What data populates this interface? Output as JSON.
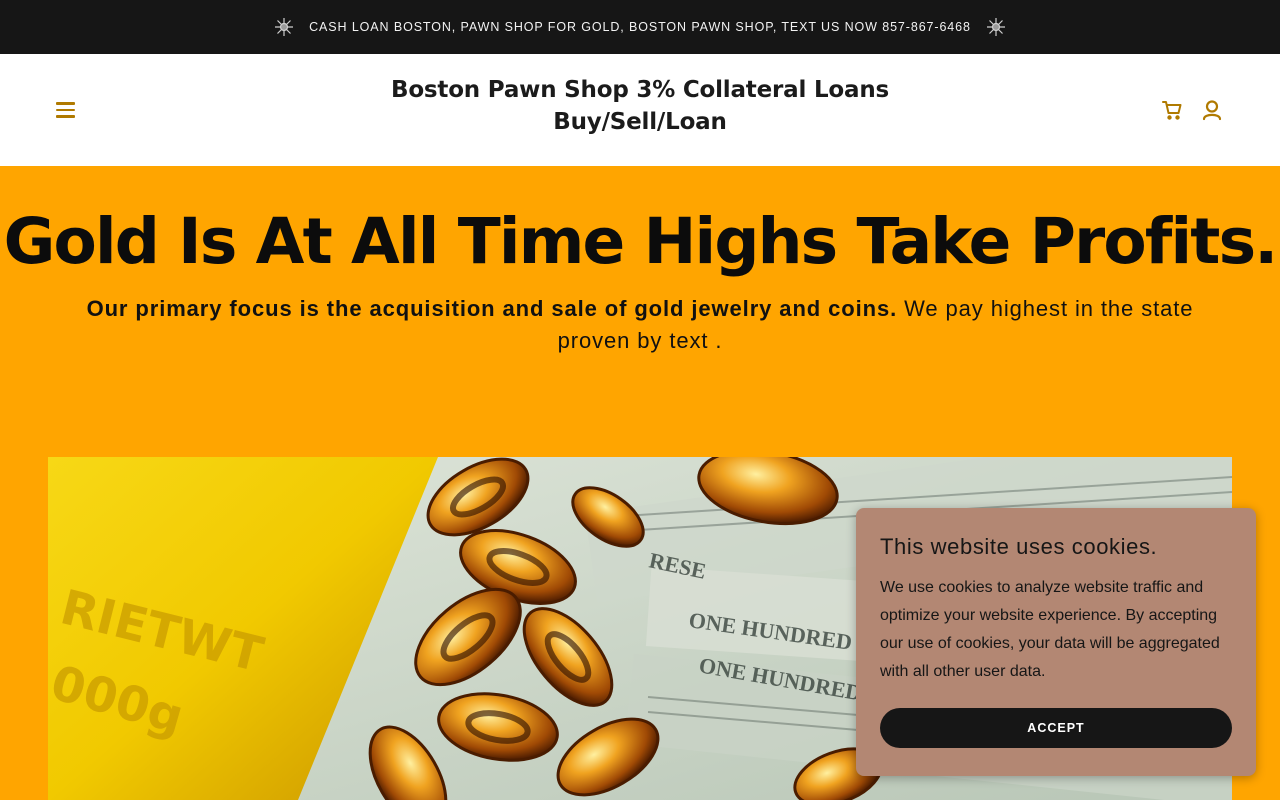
{
  "announcement": {
    "text": "CASH LOAN BOSTON, PAWN SHOP FOR GOLD, BOSTON PAWN SHOP, TEXT US NOW 857-867-6468",
    "icon": "sparkle-icon"
  },
  "header": {
    "title_line1": "Boston Pawn Shop 3% Collateral Loans",
    "title_line2": "Buy/Sell/Loan",
    "menu_icon": "hamburger-menu-icon",
    "cart_icon": "shopping-cart-icon",
    "account_icon": "user-account-icon",
    "icon_color": "#b07a00"
  },
  "hero": {
    "heading": "Gold Is At All Time Highs Take Profits.",
    "text_bold": "Our primary focus is the acquisition and sale of gold jewelry and coins.",
    "text_regular": " We pay highest in the state proven by text .",
    "background": "#ffa500",
    "image_text": [
      "RIETWT",
      "000g",
      "ONE HUNDRED",
      "ONE HUNDRED",
      "RESE"
    ]
  },
  "cookie_banner": {
    "title": "This website uses cookies.",
    "body": "We use cookies to analyze website traffic and optimize your website experience. By accepting our use of cookies, your data will be aggregated with all other user data.",
    "accept_label": "ACCEPT",
    "background": "#b38773"
  }
}
